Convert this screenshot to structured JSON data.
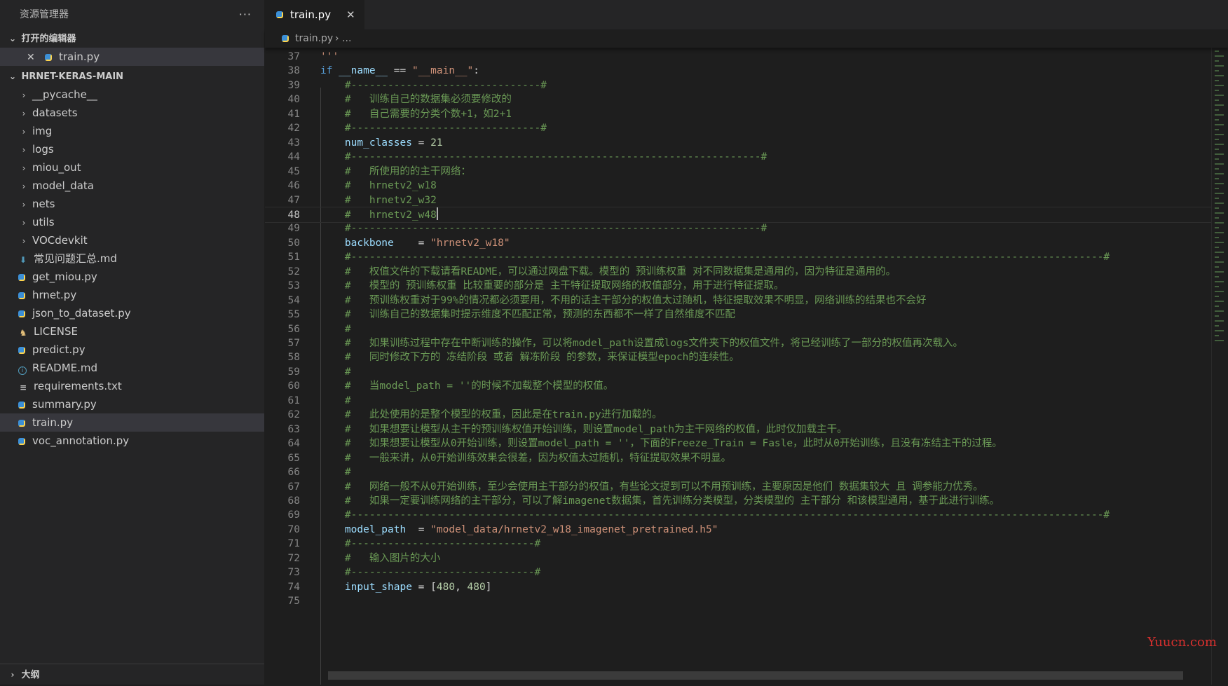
{
  "sidebar": {
    "title": "资源管理器",
    "more": "···",
    "open_editors": {
      "label": "打开的编辑器",
      "items": [
        {
          "name": "train.py"
        }
      ]
    },
    "project": {
      "label": "HRNET-KERAS-MAIN",
      "folders": [
        "__pycache__",
        "datasets",
        "img",
        "logs",
        "miou_out",
        "model_data",
        "nets",
        "utils",
        "VOCdevkit"
      ],
      "files": [
        {
          "name": "常见问题汇总.md",
          "icon": "markdown-icon"
        },
        {
          "name": "get_miou.py",
          "icon": "python-icon"
        },
        {
          "name": "hrnet.py",
          "icon": "python-icon"
        },
        {
          "name": "json_to_dataset.py",
          "icon": "python-icon"
        },
        {
          "name": "LICENSE",
          "icon": "license-icon"
        },
        {
          "name": "predict.py",
          "icon": "python-icon"
        },
        {
          "name": "README.md",
          "icon": "info-icon"
        },
        {
          "name": "requirements.txt",
          "icon": "text-file-icon"
        },
        {
          "name": "summary.py",
          "icon": "python-icon"
        },
        {
          "name": "train.py",
          "icon": "python-icon",
          "selected": true
        },
        {
          "name": "voc_annotation.py",
          "icon": "python-icon"
        }
      ]
    },
    "outline_label": "大纲"
  },
  "tab": {
    "label": "train.py",
    "close": "✕"
  },
  "breadcrumb": {
    "file": "train.py",
    "more": "..."
  },
  "editor": {
    "current_line": 48,
    "lines": [
      {
        "n": "37",
        "t": [
          [
            "'''",
            "str"
          ]
        ]
      },
      {
        "n": "38",
        "t": [
          [
            "if ",
            "kw"
          ],
          [
            "__name__",
            "var"
          ],
          [
            " == ",
            "op"
          ],
          [
            "\"__main__\"",
            "str"
          ],
          [
            ":",
            "op"
          ]
        ]
      },
      {
        "n": "39",
        "t": [
          [
            "    #-------------------------------#",
            "cmt"
          ]
        ]
      },
      {
        "n": "40",
        "t": [
          [
            "    #   训练自己的数据集必须要修改的",
            "cmt"
          ]
        ]
      },
      {
        "n": "41",
        "t": [
          [
            "    #   自己需要的分类个数+1，如2+1",
            "cmt"
          ]
        ]
      },
      {
        "n": "42",
        "t": [
          [
            "    #-------------------------------#",
            "cmt"
          ]
        ]
      },
      {
        "n": "43",
        "t": [
          [
            "    ",
            "op"
          ],
          [
            "num_classes",
            "var"
          ],
          [
            " = ",
            "op"
          ],
          [
            "21",
            "num"
          ]
        ]
      },
      {
        "n": "44",
        "t": [
          [
            "    #-------------------------------------------------------------------#",
            "cmt"
          ]
        ]
      },
      {
        "n": "45",
        "t": [
          [
            "    #   所使用的的主干网络：",
            "cmt"
          ]
        ]
      },
      {
        "n": "46",
        "t": [
          [
            "    #   hrnetv2_w18",
            "cmt"
          ]
        ]
      },
      {
        "n": "47",
        "t": [
          [
            "    #   hrnetv2_w32",
            "cmt"
          ]
        ]
      },
      {
        "n": "48",
        "t": [
          [
            "    #   hrnetv2_w48",
            "cmt"
          ]
        ]
      },
      {
        "n": "49",
        "t": [
          [
            "    #-------------------------------------------------------------------#",
            "cmt"
          ]
        ]
      },
      {
        "n": "50",
        "t": [
          [
            "    ",
            "op"
          ],
          [
            "backbone",
            "var"
          ],
          [
            "    = ",
            "op"
          ],
          [
            "\"hrnetv2_w18\"",
            "str"
          ]
        ]
      },
      {
        "n": "51",
        "t": [
          [
            "    #---------------------------------------------------------------------------------------------------------------------------#",
            "cmt"
          ]
        ]
      },
      {
        "n": "52",
        "t": [
          [
            "    #   权值文件的下载请看README，可以通过网盘下载。模型的 预训练权重 对不同数据集是通用的，因为特征是通用的。",
            "cmt"
          ]
        ]
      },
      {
        "n": "53",
        "t": [
          [
            "    #   模型的 预训练权重 比较重要的部分是 主干特征提取网络的权值部分，用于进行特征提取。",
            "cmt"
          ]
        ]
      },
      {
        "n": "54",
        "t": [
          [
            "    #   预训练权重对于99%的情况都必须要用，不用的话主干部分的权值太过随机，特征提取效果不明显，网络训练的结果也不会好",
            "cmt"
          ]
        ]
      },
      {
        "n": "55",
        "t": [
          [
            "    #   训练自己的数据集时提示维度不匹配正常，预测的东西都不一样了自然维度不匹配",
            "cmt"
          ]
        ]
      },
      {
        "n": "56",
        "t": [
          [
            "    #",
            "cmt"
          ]
        ]
      },
      {
        "n": "57",
        "t": [
          [
            "    #   如果训练过程中存在中断训练的操作，可以将model_path设置成logs文件夹下的权值文件，将已经训练了一部分的权值再次载入。",
            "cmt"
          ]
        ]
      },
      {
        "n": "58",
        "t": [
          [
            "    #   同时修改下方的 冻结阶段 或者 解冻阶段 的参数，来保证模型epoch的连续性。",
            "cmt"
          ]
        ]
      },
      {
        "n": "59",
        "t": [
          [
            "    #",
            "cmt"
          ]
        ]
      },
      {
        "n": "60",
        "t": [
          [
            "    #   当model_path = ''的时候不加载整个模型的权值。",
            "cmt"
          ]
        ]
      },
      {
        "n": "61",
        "t": [
          [
            "    #",
            "cmt"
          ]
        ]
      },
      {
        "n": "62",
        "t": [
          [
            "    #   此处使用的是整个模型的权重，因此是在train.py进行加载的。",
            "cmt"
          ]
        ]
      },
      {
        "n": "63",
        "t": [
          [
            "    #   如果想要让模型从主干的预训练权值开始训练，则设置model_path为主干网络的权值，此时仅加载主干。",
            "cmt"
          ]
        ]
      },
      {
        "n": "64",
        "t": [
          [
            "    #   如果想要让模型从0开始训练，则设置model_path = ''，下面的Freeze_Train = Fasle，此时从0开始训练，且没有冻结主干的过程。",
            "cmt"
          ]
        ]
      },
      {
        "n": "65",
        "t": [
          [
            "    #   一般来讲，从0开始训练效果会很差，因为权值太过随机，特征提取效果不明显。",
            "cmt"
          ]
        ]
      },
      {
        "n": "66",
        "t": [
          [
            "    #",
            "cmt"
          ]
        ]
      },
      {
        "n": "67",
        "t": [
          [
            "    #   网络一般不从0开始训练，至少会使用主干部分的权值，有些论文提到可以不用预训练，主要原因是他们 数据集较大 且 调参能力优秀。",
            "cmt"
          ]
        ]
      },
      {
        "n": "68",
        "t": [
          [
            "    #   如果一定要训练网络的主干部分，可以了解imagenet数据集，首先训练分类模型，分类模型的 主干部分 和该模型通用，基于此进行训练。",
            "cmt"
          ]
        ]
      },
      {
        "n": "69",
        "t": [
          [
            "    #---------------------------------------------------------------------------------------------------------------------------#",
            "cmt"
          ]
        ]
      },
      {
        "n": "70",
        "t": [
          [
            "    ",
            "op"
          ],
          [
            "model_path",
            "var"
          ],
          [
            "  = ",
            "op"
          ],
          [
            "\"model_data/hrnetv2_w18_imagenet_pretrained.h5\"",
            "str"
          ]
        ]
      },
      {
        "n": "71",
        "t": [
          [
            "    #------------------------------#",
            "cmt"
          ]
        ]
      },
      {
        "n": "72",
        "t": [
          [
            "    #   输入图片的大小",
            "cmt"
          ]
        ]
      },
      {
        "n": "73",
        "t": [
          [
            "    #------------------------------#",
            "cmt"
          ]
        ]
      },
      {
        "n": "74",
        "t": [
          [
            "    ",
            "op"
          ],
          [
            "input_shape",
            "var"
          ],
          [
            " = [",
            "op"
          ],
          [
            "480",
            "num"
          ],
          [
            ", ",
            "op"
          ],
          [
            "480",
            "num"
          ],
          [
            "]",
            "op"
          ]
        ]
      },
      {
        "n": "75",
        "t": [
          [
            "",
            "op"
          ]
        ]
      }
    ]
  },
  "watermark": "Yuucn.com"
}
